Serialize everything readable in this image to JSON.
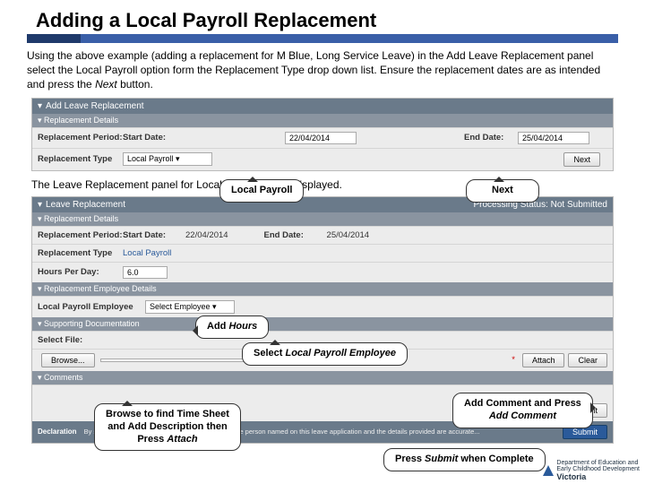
{
  "title": "Adding a Local Payroll Replacement",
  "intro_part1": "Using the above example (adding a replacement for M Blue, Long Service Leave) in the Add Leave Replacement panel select the Local Payroll option form the Replacement Type drop down list. Ensure the replacement dates are as intended and press the ",
  "intro_italic": "Next",
  "intro_part2": " button.",
  "panel1": {
    "header": "Add Leave Replacement",
    "sub": "Replacement Details",
    "period_label": "Replacement Period:",
    "start_label": "Start Date:",
    "start_value": "22/04/2014",
    "end_label": "End Date:",
    "end_value": "25/04/2014",
    "type_label": "Replacement Type",
    "type_value": "Local Payroll",
    "next_btn": "Next"
  },
  "callouts": {
    "local_payroll": "Local Payroll",
    "next": "Next",
    "add_hours_pre": "Add ",
    "add_hours_italic": "Hours",
    "select_emp_pre": "Select ",
    "select_emp_italic": "Local Payroll Employee",
    "browse_line1": "Browse to find Time Sheet",
    "browse_line2": "and Add Description then",
    "browse_pre": "Press ",
    "browse_italic": "Attach",
    "comment_line1": "Add Comment and Press",
    "comment_italic": "Add Comment",
    "submit_pre": "Press ",
    "submit_italic": "Submit",
    "submit_post": " when Complete"
  },
  "mid": "The Leave Replacement panel for Local Payroll will be displayed.",
  "panel2": {
    "header": "Leave Replacement",
    "status": "Processing Status: Not Submitted",
    "sub_details": "Replacement Details",
    "period_label": "Replacement Period:",
    "start_label": "Start Date:",
    "start_value": "22/04/2014",
    "end_label": "End Date:",
    "end_value": "25/04/2014",
    "type_label": "Replacement Type",
    "type_value": "Local Payroll",
    "hours_label": "Hours Per Day:",
    "hours_value": "6.0",
    "sub_emp": "Replacement Employee Details",
    "emp_label": "Local Payroll Employee",
    "emp_value": "Select Employee",
    "sub_doc": "Supporting Documentation",
    "file_label": "Select File:",
    "browse_btn": "Browse...",
    "attach_btn": "Attach",
    "clear_btn": "Clear",
    "sub_comments": "Comments",
    "add_comment_btn": "Add Comment",
    "decl_label": "Declaration",
    "decl_text": "By selecting the Submit button, I confirm that I am the person named on this leave application and the details provided are accurate...",
    "submit_btn": "Submit"
  },
  "footer": {
    "line1": "Department of Education and",
    "line2": "Early Childhood Development",
    "brand": "Victoria"
  }
}
